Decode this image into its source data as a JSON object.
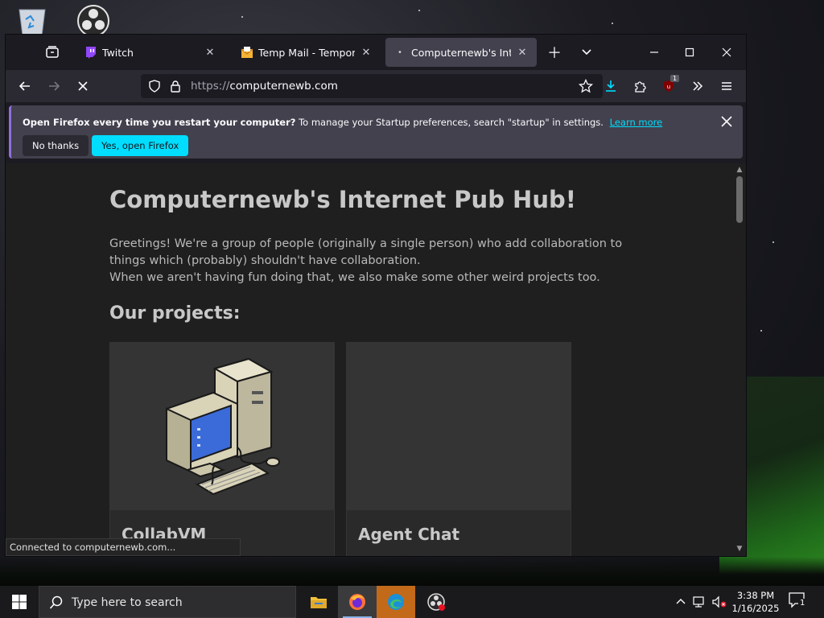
{
  "browser": {
    "tabs": [
      {
        "title": "Twitch",
        "active": false
      },
      {
        "title": "Temp Mail - Temporary Disposable Email",
        "active": false
      },
      {
        "title": "Computernewb's Internet Pub Hub!",
        "active": true
      }
    ],
    "url": {
      "scheme": "https://",
      "host": "computernewb.com"
    },
    "extension_badge": "1",
    "notification": {
      "bold_text": "Open Firefox every time you restart your computer?",
      "text": "To manage your Startup preferences, search \"startup\" in settings.",
      "link_label": "Learn more",
      "no_label": "No thanks",
      "yes_label": "Yes, open Firefox"
    },
    "status_text": "Connected to computernewb.com..."
  },
  "page": {
    "title": "Computernewb's Internet Pub Hub!",
    "intro_line1": "Greetings! We're a group of people (originally a single person) who add collaboration to things which (probably) shouldn't have collaboration.",
    "intro_line2": "When we aren't having fun doing that, we also make some other weird projects too.",
    "projects_heading": "Our projects:",
    "projects": [
      {
        "name": "CollabVM"
      },
      {
        "name": "Agent Chat"
      }
    ]
  },
  "taskbar": {
    "search_placeholder": "Type here to search",
    "time": "3:38 PM",
    "date": "1/16/2025",
    "notification_count": "1"
  },
  "colors": {
    "accent": "#00ddff",
    "tab_active": "#42414d",
    "toolbar": "#2b2a33",
    "page_bg": "#1f1f1f"
  }
}
